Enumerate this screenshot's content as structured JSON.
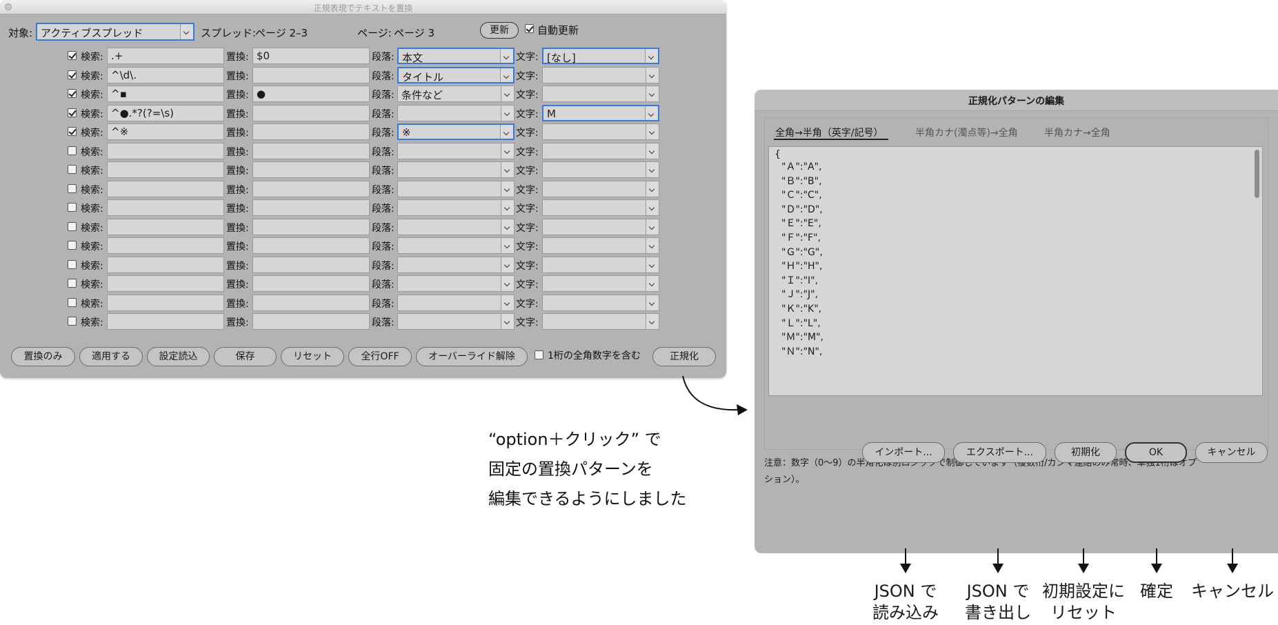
{
  "main": {
    "title": "正規表現でテキストを置換",
    "target_label": "対象:",
    "target_value": "アクティブスプレッド",
    "spread_label": "スプレッド:",
    "spread_value": "ページ 2–3",
    "page_label": "ページ:",
    "page_value": "ページ 3",
    "update_button": "更新",
    "auto_update_label": "自動更新",
    "search_label": "検索:",
    "replace_label": "置換:",
    "para_label": "段落:",
    "char_label": "文字:",
    "rows": [
      {
        "checked": true,
        "search": ".+",
        "replace": "$0",
        "para": "本文",
        "char": "[なし]"
      },
      {
        "checked": true,
        "search": "^\\d\\.",
        "replace": "",
        "para": "タイトル",
        "char": ""
      },
      {
        "checked": true,
        "search": "^▪",
        "replace": "●",
        "para": "条件など",
        "char": ""
      },
      {
        "checked": true,
        "search": "^●.*?(?=\\s)",
        "replace": "",
        "para": "",
        "char": "M"
      },
      {
        "checked": true,
        "search": "^※",
        "replace": "",
        "para": "※",
        "char": ""
      },
      {
        "checked": false,
        "search": "",
        "replace": "",
        "para": "",
        "char": ""
      },
      {
        "checked": false,
        "search": "",
        "replace": "",
        "para": "",
        "char": ""
      },
      {
        "checked": false,
        "search": "",
        "replace": "",
        "para": "",
        "char": ""
      },
      {
        "checked": false,
        "search": "",
        "replace": "",
        "para": "",
        "char": ""
      },
      {
        "checked": false,
        "search": "",
        "replace": "",
        "para": "",
        "char": ""
      },
      {
        "checked": false,
        "search": "",
        "replace": "",
        "para": "",
        "char": ""
      },
      {
        "checked": false,
        "search": "",
        "replace": "",
        "para": "",
        "char": ""
      },
      {
        "checked": false,
        "search": "",
        "replace": "",
        "para": "",
        "char": ""
      },
      {
        "checked": false,
        "search": "",
        "replace": "",
        "para": "",
        "char": ""
      },
      {
        "checked": false,
        "search": "",
        "replace": "",
        "para": "",
        "char": ""
      }
    ],
    "buttons": {
      "replace_only": "置換のみ",
      "apply": "適用する",
      "load_settings": "設定読込",
      "save": "保存",
      "reset": "リセット",
      "all_off": "全行OFF",
      "clear_override": "オーバーライド解除",
      "include_single_digit": "1桁の全角数字を含む",
      "normalize": "正規化"
    }
  },
  "edit": {
    "title": "正規化パターンの編集",
    "tabs": [
      "全角→半角（英字/記号）",
      "半角カナ(濁点等)→全角",
      "半角カナ→全角"
    ],
    "code_open": "{",
    "code_lines": [
      "\"Ａ\":\"A\",",
      "\"Ｂ\":\"B\",",
      "\"Ｃ\":\"C\",",
      "\"Ｄ\":\"D\",",
      "\"Ｅ\":\"E\",",
      "\"Ｆ\":\"F\",",
      "\"Ｇ\":\"G\",",
      "\"Ｈ\":\"H\",",
      "\"Ｉ\":\"I\",",
      "\"Ｊ\":\"J\",",
      "\"Ｋ\":\"K\",",
      "\"Ｌ\":\"L\",",
      "\"Ｍ\":\"M\",",
      "\"Ｎ\":\"N\","
    ],
    "note_line1": "注意：数字（0〜9）の半角化は別ロジックで制御しています（複数桁/カンマ連結のみ常時、単独1桁はオプ",
    "note_line2": "ション）。",
    "buttons": {
      "import": "インポート...",
      "export": "エクスポート...",
      "initialize": "初期化",
      "ok": "OK",
      "cancel": "キャンセル"
    }
  },
  "annotations": {
    "center_line1": "“option＋クリック” で",
    "center_line2": "固定の置換パターンを",
    "center_line3": "編集できるようにしました",
    "import_l1": "JSON で",
    "import_l2": "読み込み",
    "export_l1": "JSON で",
    "export_l2": "書き出し",
    "init_l1": "初期設定に",
    "init_l2": "リセット",
    "ok_l1": "確定",
    "cancel_l1": "キャンセル"
  }
}
